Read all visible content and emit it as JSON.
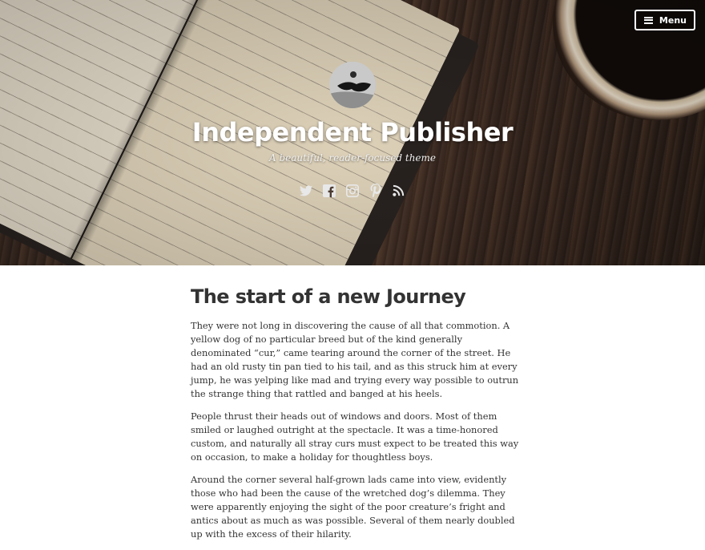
{
  "header": {
    "menu_label": "Menu",
    "site_title": "Independent Publisher",
    "tagline": "A beautiful, reader-focused theme",
    "social_icons": [
      "twitter-icon",
      "facebook-icon",
      "instagram-icon",
      "pinterest-icon",
      "rss-icon"
    ]
  },
  "post": {
    "title": "The start of a new Journey",
    "paragraphs": [
      "They were not long in discovering the cause of all that commotion. A yellow dog of no particular breed but of the kind generally denominated “cur,” came tearing around the corner of the street. He had an old rusty tin pan tied to his tail, and as this struck him at every jump, he was yelping like mad and trying every way possible to outrun the strange thing that rattled and banged at his heels.",
      "People thrust their heads out of windows and doors. Most of them smiled or laughed outright at the spectacle. It was a time-honored custom, and naturally all stray curs must expect to be treated this way on occasion, to make a holiday for thoughtless boys.",
      "Around the corner several half-grown lads came into view, evidently those who had been the cause of the wretched dog’s dilemma. They were apparently enjoying the sight of the poor creature’s fright and antics about as much as was possible. Several of them nearly doubled up with the excess of their hilarity."
    ]
  },
  "colors": {
    "text": "#333333",
    "header_text": "#ffffff",
    "background": "#ffffff"
  }
}
